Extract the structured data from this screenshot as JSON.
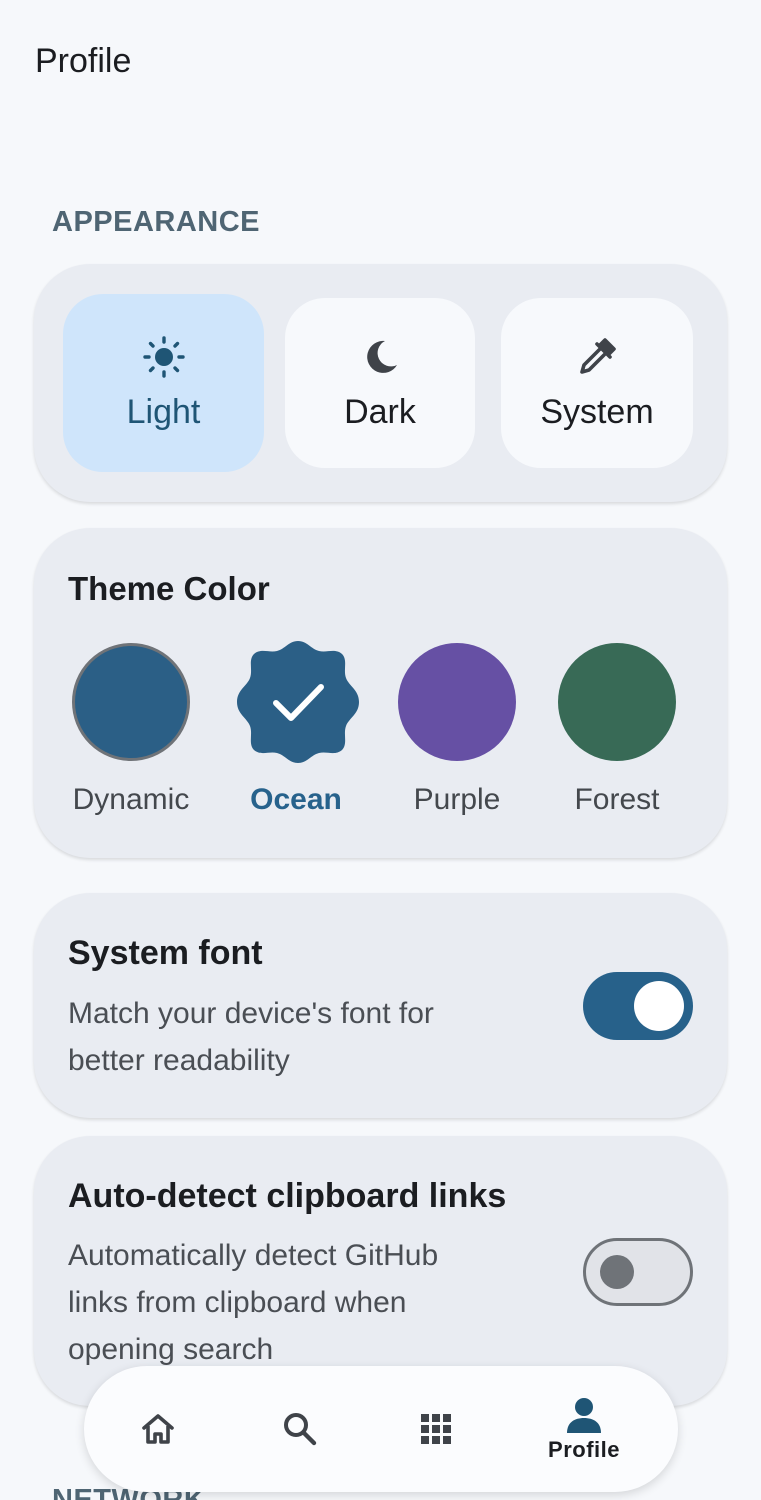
{
  "header": {
    "title": "Profile"
  },
  "sections": {
    "appearance": "APPEARANCE",
    "network": "NETWORK"
  },
  "appearance_modes": [
    {
      "label": "Light",
      "icon": "sun-icon",
      "selected": true
    },
    {
      "label": "Dark",
      "icon": "moon-icon",
      "selected": false
    },
    {
      "label": "System",
      "icon": "eyedropper-icon",
      "selected": false
    }
  ],
  "theme_color": {
    "title": "Theme Color",
    "options": [
      {
        "label": "Dynamic",
        "color": "#2b5f86",
        "selected": false
      },
      {
        "label": "Ocean",
        "color": "#2b5f86",
        "selected": true
      },
      {
        "label": "Purple",
        "color": "#6650a4",
        "selected": false
      },
      {
        "label": "Forest",
        "color": "#386a56",
        "selected": false
      }
    ]
  },
  "settings": [
    {
      "title": "System font",
      "description_lines": [
        "Match your device's font for",
        "better readability"
      ],
      "enabled": true
    },
    {
      "title": "Auto-detect clipboard links",
      "description_lines": [
        "Automatically detect GitHub",
        "links from clipboard when",
        "opening search"
      ],
      "enabled": false
    }
  ],
  "bottom_nav": {
    "items": [
      {
        "icon": "home-icon",
        "label": ""
      },
      {
        "icon": "search-icon",
        "label": ""
      },
      {
        "icon": "apps-grid-icon",
        "label": ""
      },
      {
        "icon": "person-icon",
        "label": "Profile",
        "active": true
      }
    ]
  },
  "colors": {
    "accent": "#27618a",
    "selected_mode_bg": "#cfe5fb",
    "card_bg": "#e9ecf2",
    "page_bg": "#f6f8fb"
  }
}
